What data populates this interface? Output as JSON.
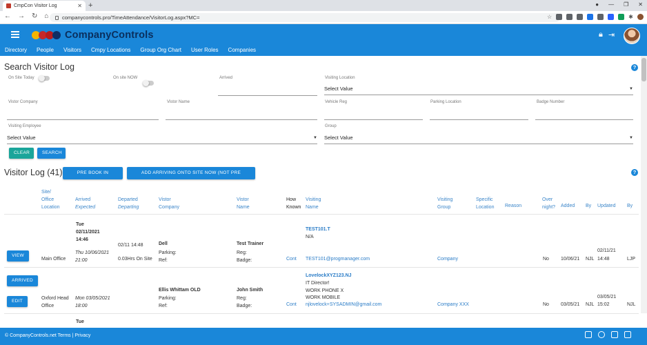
{
  "browser": {
    "tab_title": "CmpCon Visitor Log",
    "url": "companycontrols.pro/TimeAttendance/VisitorLog.aspx?MC="
  },
  "app": {
    "brand": "CompanyControls",
    "nav": [
      "Directory",
      "People",
      "Visitors",
      "Cmpy Locations",
      "Group Org Chart",
      "User Roles",
      "Companies"
    ]
  },
  "search": {
    "title": "Search Visitor Log",
    "on_site_today": "On Site Today",
    "on_site_now": "On site NOW",
    "arrived": "Arrived",
    "visiting_location": "Visiting Location",
    "visiting_location_value": "Select Value",
    "visitor_company": "Vistor Company",
    "visitor_name": "Vistor Name",
    "vehicle_reg": "Vehicle Reg",
    "parking_location": "Parking Location",
    "badge_number": "Badge Number",
    "visiting_employee": "Visiting Employee",
    "visiting_employee_value": "Select Value",
    "group": "Group",
    "group_value": "Select Value",
    "clear_label": "CLEAR",
    "search_label": "SEARCH"
  },
  "log": {
    "title": "Visitor Log (41)",
    "prebook_label": "PRE BOOK IN VISITOR",
    "add_arriving_label": "ADD ARRIVING ONTO SITE NOW (NOT PRE BOOKED)",
    "headers": {
      "site_1": "Site/",
      "site_2": "Office",
      "site_3": "Location",
      "arrived": "Arrived",
      "expected": "Expected",
      "departed": "Departed",
      "departing": "Departing",
      "vistor_1": "Vistor",
      "company": "Company",
      "vistor_2": "Vistor",
      "name": "Name",
      "how": "How",
      "known": "Known",
      "visiting_1": "Visiting",
      "visiting_name": "Name",
      "visiting_2": "Visiting",
      "group": "Group",
      "specific": "Specific",
      "location": "Location",
      "reason": "Reason",
      "over": "Over",
      "night": "night?",
      "added": "Added",
      "by1": "By",
      "updated": "Updated",
      "by2": "By"
    },
    "rows": [
      {
        "view_label": "VIEW",
        "day": "Tue",
        "date": "02/11/2021",
        "time": "14:46",
        "location": "Main Office",
        "expected": "Thu 10/06/2021",
        "expected_time": "21:00",
        "departed": "02/11 14:48",
        "duration": "0.03Hrs On Site",
        "company": "Dell",
        "parking_lbl": "Parking:",
        "ref_lbl": "Ref:",
        "name": "Test Trainer",
        "reg_lbl": "Reg:",
        "badge_lbl": "Badge:",
        "how_known": "Cont",
        "visiting_code": "TEST101.T",
        "visiting_sub": "N/A",
        "visiting_email": "TEST101@progmanager.com",
        "group": "Company",
        "overnight": "No",
        "added": "10/06/21",
        "added_by": "NJL",
        "updated_date": "02/11/21",
        "updated_time": "14:48",
        "updated_by": "LJP"
      },
      {
        "arrived_label": "ARRIVED",
        "edit_label": "EDIT",
        "location_1": "Oxford Head",
        "location_2": "Office",
        "expected": "Mon 03/05/2021",
        "expected_time": "18:00",
        "company": "Ellis Whittam OLD",
        "parking_lbl": "Parking:",
        "ref_lbl": "Ref:",
        "name": "John Smith",
        "reg_lbl": "Reg:",
        "badge_lbl": "Badge:",
        "how_known": "Cont",
        "visiting_code": "LovelockXYZ123.NJ",
        "visiting_line1": "IT Director!",
        "visiting_line2": "WORK PHONE X",
        "visiting_line3": "WORK MOBILE",
        "visiting_email": "njlovelock+SYSADMIN@gmail.com",
        "group": "Company XXX",
        "overnight": "No",
        "added": "03/05/21",
        "added_by": "NJL",
        "updated_date": "03/05/21",
        "updated_time": "15:02",
        "updated_by": "NJL"
      },
      {
        "day": "Tue"
      }
    ]
  },
  "footer": {
    "text": "© CompanyControls.net Terms | Privacy"
  },
  "colors": {
    "primary": "#1a87d9",
    "teal": "#1aa59a",
    "link": "#2a7cc7"
  }
}
